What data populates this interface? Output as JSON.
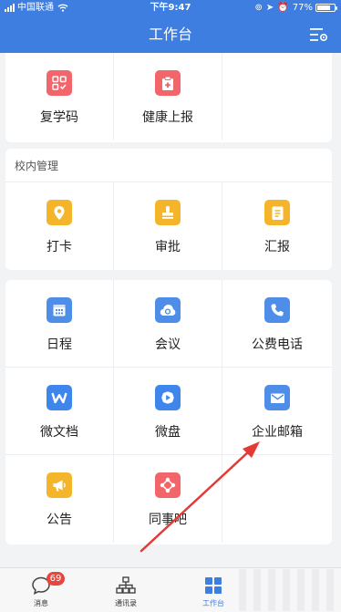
{
  "status_bar": {
    "carrier": "中国联通",
    "time": "下午9:47",
    "battery": "77%",
    "battery_level": 0.77
  },
  "nav": {
    "title": "工作台",
    "menu_icon": "settings-list-icon"
  },
  "card1": {
    "items": [
      {
        "label": "复学码",
        "icon": "grid-code-icon",
        "color": "#f2656a"
      },
      {
        "label": "健康上报",
        "icon": "medical-clipboard-icon",
        "color": "#f2656a"
      }
    ]
  },
  "card2": {
    "title": "校内管理",
    "items": [
      {
        "label": "打卡",
        "icon": "location-pin-icon",
        "color": "#f4b52b"
      },
      {
        "label": "审批",
        "icon": "stamp-icon",
        "color": "#f4b52b"
      },
      {
        "label": "汇报",
        "icon": "report-icon",
        "color": "#f4b52b"
      }
    ]
  },
  "card3": {
    "items": [
      {
        "label": "日程",
        "icon": "calendar-icon",
        "color": "#4e8ee8"
      },
      {
        "label": "会议",
        "icon": "cloud-meeting-icon",
        "color": "#4e8ee8"
      },
      {
        "label": "公费电话",
        "icon": "phone-icon",
        "color": "#4e8ee8"
      },
      {
        "label": "微文档",
        "icon": "doc-w-icon",
        "color": "#3f86ec"
      },
      {
        "label": "微盘",
        "icon": "drive-icon",
        "color": "#3f86ec"
      },
      {
        "label": "企业邮箱",
        "icon": "mail-icon",
        "color": "#4e8ee8"
      },
      {
        "label": "公告",
        "icon": "megaphone-icon",
        "color": "#f4b52b"
      },
      {
        "label": "同事吧",
        "icon": "colleague-network-icon",
        "color": "#f2656a"
      }
    ]
  },
  "tabbar": {
    "tabs": [
      {
        "label": "消息",
        "icon": "message-icon",
        "badge": "69"
      },
      {
        "label": "通讯录",
        "icon": "contacts-tree-icon"
      },
      {
        "label": "工作台",
        "icon": "workbench-grid-icon",
        "active": true
      }
    ]
  },
  "colors": {
    "primary": "#3d7ee0",
    "annotation_arrow": "#e53935"
  }
}
